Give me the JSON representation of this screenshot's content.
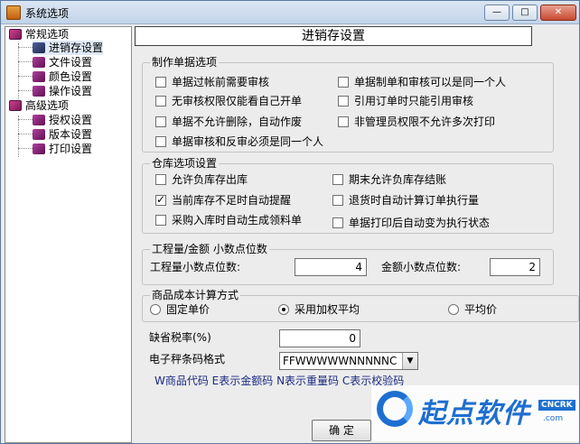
{
  "window": {
    "title": "系统选项",
    "min": "—",
    "max": "□",
    "close": "✕"
  },
  "tree": {
    "groups": [
      {
        "label": "常规选项",
        "items": [
          "进销存设置",
          "文件设置",
          "颜色设置",
          "操作设置"
        ]
      },
      {
        "label": "高级选项",
        "items": [
          "授权设置",
          "版本设置",
          "打印设置"
        ]
      }
    ]
  },
  "header": "进销存设置",
  "docs": {
    "title": "制作单据选项",
    "options": [
      {
        "label": "单据过帐前需要审核",
        "checked": false
      },
      {
        "label": "单据制单和审核可以是同一个人",
        "checked": false
      },
      {
        "label": "无审核权限仅能看自己开单",
        "checked": false
      },
      {
        "label": "引用订单时只能引用审核",
        "checked": false
      },
      {
        "label": "单据不允许删除，自动作废",
        "checked": false
      },
      {
        "label": "非管理员权限不允许多次打印",
        "checked": false
      },
      {
        "label": "单据审核和反审必须是同一个人",
        "checked": false
      }
    ]
  },
  "warehouse": {
    "title": "仓库选项设置",
    "options": [
      {
        "label": "允许负库存出库",
        "checked": false
      },
      {
        "label": "期末允许负库存结账",
        "checked": false
      },
      {
        "label": "当前库存不足时自动提醒",
        "checked": true
      },
      {
        "label": "退货时自动计算订单执行量",
        "checked": false
      },
      {
        "label": "采购入库时自动生成领料单",
        "checked": false
      },
      {
        "label": "单据打印后自动变为执行状态",
        "checked": false
      }
    ]
  },
  "decimals": {
    "title": "工程量/金额 小数点位数",
    "qty_label": "工程量小数点位数:",
    "qty_value": "4",
    "amount_label": "金额小数点位数:",
    "amount_value": "2"
  },
  "cost": {
    "title": "商品成本计算方式",
    "options": [
      {
        "label": "固定单价",
        "selected": false
      },
      {
        "label": "采用加权平均",
        "selected": true
      },
      {
        "label": "平均价",
        "selected": false
      }
    ]
  },
  "tax": {
    "label": "缺省税率(%)",
    "value": "0"
  },
  "barcode": {
    "label": "电子秤条码格式",
    "value": "FFWWWWWNNNNNC",
    "hint": "W商品代码 E表示金额码 N表示重量码 C表示校验码"
  },
  "ok_label": "确 定",
  "watermark": {
    "text": "起点软件",
    "tag": "CNCRK",
    "sub": ".com"
  }
}
